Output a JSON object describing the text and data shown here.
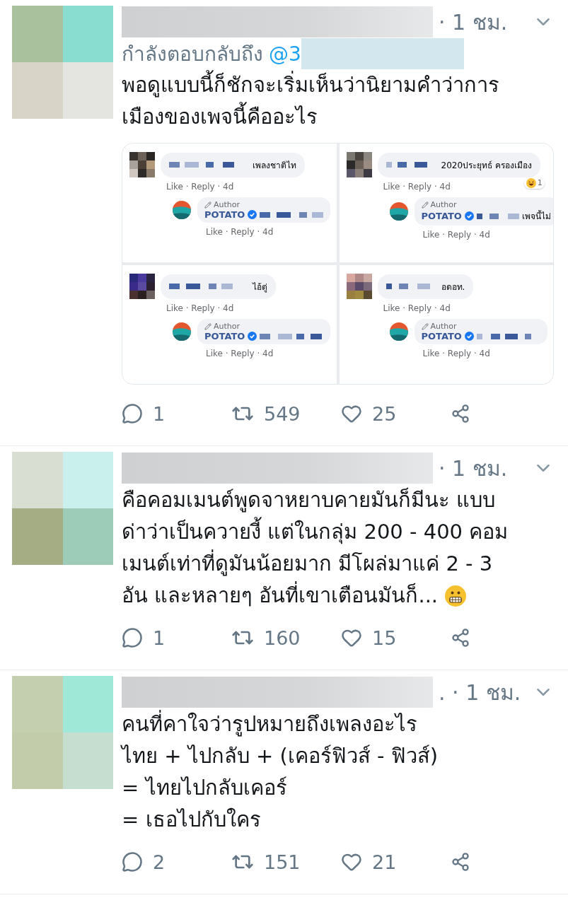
{
  "tweets": [
    {
      "time": "· 1 ชม.",
      "reply_to": {
        "label": "กำลังตอบกลับถึง",
        "handle": "@3"
      },
      "lines": [
        "พอดูแบบนี้ก็ชักจะเริ่มเห็นว่านิยามคำว่าการ",
        "เมืองของเพจนี้คืออะไร"
      ],
      "media": {
        "panels": [
          {
            "comment": "เพลงชาติไท",
            "author_label": "Author",
            "author_name": "POTATO",
            "meta": "Like · Reply · 4d",
            "reply_meta": "Like · Reply · 4d"
          },
          {
            "comment": "2020ประยุทธ์ ครองเมือง",
            "reaction": {
              "kind": "laugh",
              "count": "1"
            },
            "author_label": "Author",
            "author_name": "POTATO",
            "reply_text": "เพจนี้ไม่",
            "meta": "Like · Reply · 4d",
            "reply_meta": "Like · Reply · 4d"
          },
          {
            "comment": "ไอ้ตู่",
            "author_label": "Author",
            "author_name": "POTATO",
            "meta": "Like · Reply · 4d",
            "reply_meta": "Like · Reply · 4d"
          },
          {
            "comment": "อดอท.",
            "author_label": "Author",
            "author_name": "POTATO",
            "meta": "Like · Reply · 4d",
            "reply_meta": "Like · Reply · 4d"
          }
        ]
      },
      "actions": {
        "replies": "1",
        "retweets": "549",
        "likes": "25"
      }
    },
    {
      "time": "· 1 ชม.",
      "lines": [
        "คือคอมเมนต์พูดจาหยาบคายมันก็มีนะ แบบ",
        "ด่าว่าเป็นควายงี้ แต่ในกลุ่ม 200 - 400 คอม",
        "เมนต์เท่าที่ดูมันน้อยมาก มีโผล่มาแค่ 2 - 3",
        "อัน และหลายๆ อันที่เขาเตือนมันก็..."
      ],
      "ends_with_emoji": true,
      "actions": {
        "replies": "1",
        "retweets": "160",
        "likes": "15"
      }
    },
    {
      "time": ". · 1 ชม.",
      "lines": [
        "คนที่คาใจว่ารูปหมายถึงเพลงอะไร",
        "ไทย + ไปกลับ + (เคอร์ฟิวส์ - ฟิวส์)",
        "= ไทยไปกลับเคอร์",
        "= เธอไปกับใคร"
      ],
      "actions": {
        "replies": "2",
        "retweets": "151",
        "likes": "21"
      }
    }
  ]
}
